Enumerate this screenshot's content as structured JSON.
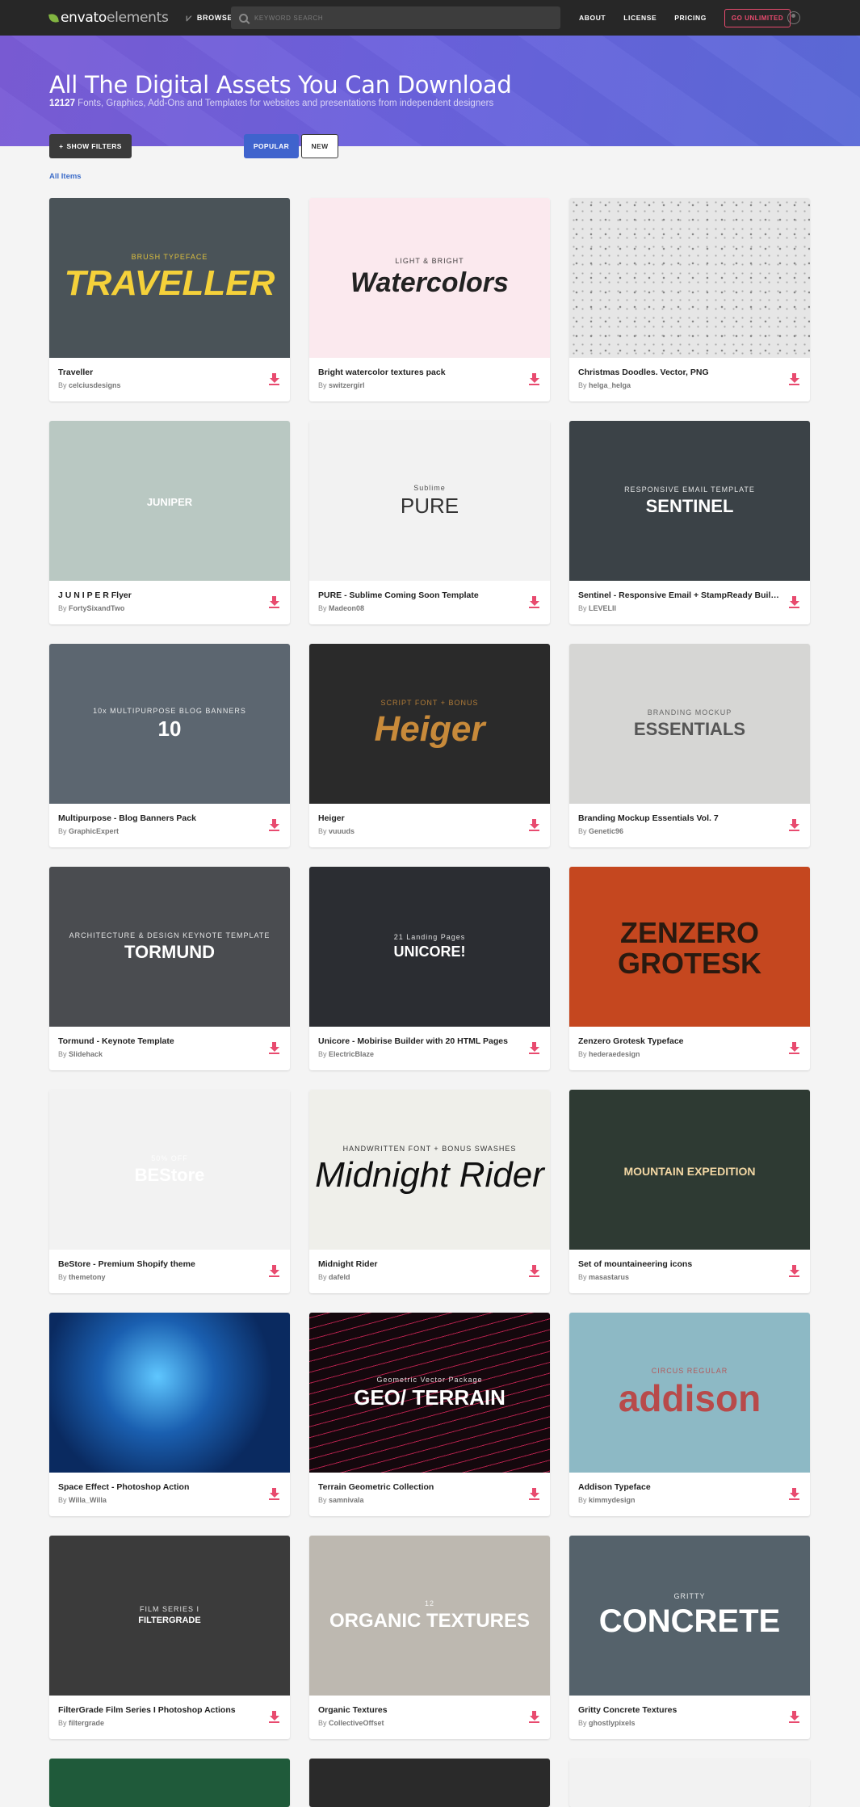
{
  "header": {
    "logo_main": "envato",
    "logo_sub": "elements",
    "browse": "BROWSE",
    "search_placeholder": "KEYWORD SEARCH",
    "nav": [
      "ABOUT",
      "LICENSE",
      "PRICING"
    ],
    "cta": "GO UNLIMITED"
  },
  "hero": {
    "title": "All The Digital Assets You Can Download",
    "count": "12127",
    "subtitle": " Fonts, Graphics, Add-Ons and Templates for websites and presentations from independent designers"
  },
  "controls": {
    "filters": "SHOW FILTERS",
    "popular": "POPULAR",
    "new": "NEW",
    "breadcrumb": "All Items"
  },
  "items": [
    {
      "title": "Traveller",
      "author": "celciusdesigns",
      "thumb_text": "TRAVELLER",
      "thumb_sub": "BRUSH TYPEFACE",
      "bg": "#4a5358"
    },
    {
      "title": "Bright watercolor textures pack",
      "author": "switzergirl",
      "thumb_text": "Watercolors",
      "thumb_sub": "LIGHT & BRIGHT",
      "bg": "#fbe9ee"
    },
    {
      "title": "Christmas Doodles. Vector, PNG",
      "author": "helga_helga",
      "thumb_text": "",
      "thumb_sub": "",
      "bg": "#e6e6e6"
    },
    {
      "title": "J U N I P E R Flyer",
      "author": "FortySixandTwo",
      "thumb_text": "JUNIPER",
      "thumb_sub": "",
      "bg": "#b9c8c2"
    },
    {
      "title": "PURE - Sublime Coming Soon Template",
      "author": "Madeon08",
      "thumb_text": "PURE",
      "thumb_sub": "Sublime",
      "bg": "#f2f2f2"
    },
    {
      "title": "Sentinel - Responsive Email + StampReady Builder",
      "author": "LEVELII",
      "thumb_text": "SENTINEL",
      "thumb_sub": "RESPONSIVE EMAIL TEMPLATE",
      "bg": "#3b4247"
    },
    {
      "title": "Multipurpose - Blog Banners Pack",
      "author": "GraphicExpert",
      "thumb_text": "10",
      "thumb_sub": "10x MULTIPURPOSE BLOG BANNERS",
      "bg": "#5c6670"
    },
    {
      "title": "Heiger",
      "author": "vuuuds",
      "thumb_text": "Heiger",
      "thumb_sub": "SCRIPT FONT + BONUS",
      "bg": "#2a2a2a"
    },
    {
      "title": "Branding Mockup Essentials Vol. 7",
      "author": "Genetic96",
      "thumb_text": "ESSENTIALS",
      "thumb_sub": "BRANDING MOCKUP",
      "bg": "#d6d6d4"
    },
    {
      "title": "Tormund - Keynote Template",
      "author": "Slidehack",
      "thumb_text": "TORMUND",
      "thumb_sub": "ARCHITECTURE & DESIGN KEYNOTE TEMPLATE",
      "bg": "#4a4c50"
    },
    {
      "title": "Unicore - Mobirise Builder with 20 HTML Pages",
      "author": "ElectricBlaze",
      "thumb_text": "UNICORE!",
      "thumb_sub": "21 Landing Pages",
      "bg": "#2b2d32"
    },
    {
      "title": "Zenzero Grotesk Typeface",
      "author": "hederaedesign",
      "thumb_text": "ZENZERO GROTESK",
      "thumb_sub": "",
      "bg": "#c5471f"
    },
    {
      "title": "BeStore - Premium Shopify theme",
      "author": "themetony",
      "thumb_text": "BEStore",
      "thumb_sub": "50% OFF",
      "bg": "#f2f2f2"
    },
    {
      "title": "Midnight Rider",
      "author": "dafeld",
      "thumb_text": "Midnight Rider",
      "thumb_sub": "HANDWRITTEN FONT + BONUS SWASHES",
      "bg": "#efefea"
    },
    {
      "title": "Set of mountaineering icons",
      "author": "masastarus",
      "thumb_text": "MOUNTAIN EXPEDITION",
      "thumb_sub": "",
      "bg": "#2e3a33"
    },
    {
      "title": "Space Effect - Photoshop Action",
      "author": "Willa_Willa",
      "thumb_text": "",
      "thumb_sub": "",
      "bg": "#0d3a7a"
    },
    {
      "title": "Terrain Geometric Collection",
      "author": "samnivala",
      "thumb_text": "GEO/ TERRAIN",
      "thumb_sub": "Geometric Vector Package",
      "bg": "#14080d"
    },
    {
      "title": "Addison Typeface",
      "author": "kimmydesign",
      "thumb_text": "addison",
      "thumb_sub": "CIRCUS REGULAR",
      "bg": "#8db9c5"
    },
    {
      "title": "FilterGrade Film Series I Photoshop Actions",
      "author": "filtergrade",
      "thumb_text": "FILTERGRADE",
      "thumb_sub": "FILM SERIES I",
      "bg": "#3b3b3b"
    },
    {
      "title": "Organic Textures",
      "author": "CollectiveOffset",
      "thumb_text": "ORGANIC TEXTURES",
      "thumb_sub": "12",
      "bg": "#bdb8b0"
    },
    {
      "title": "Gritty Concrete Textures",
      "author": "ghostlypixels",
      "thumb_text": "CONCRETE",
      "thumb_sub": "GRITTY",
      "bg": "#55626b"
    }
  ],
  "by_prefix": "By ",
  "colors": {
    "accent": "#e84b6f",
    "primary": "#3f63cd",
    "header": "#272727"
  }
}
